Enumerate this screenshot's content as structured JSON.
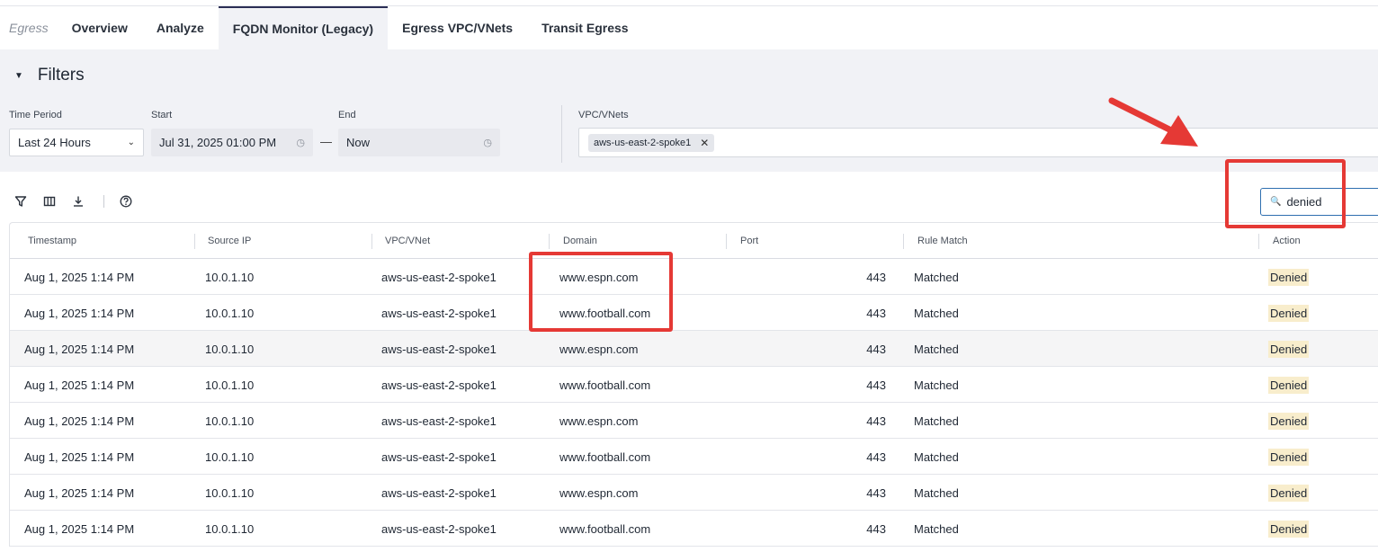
{
  "tabs": {
    "section": "Egress",
    "items": [
      "Overview",
      "Analyze",
      "FQDN Monitor (Legacy)",
      "Egress VPC/VNets",
      "Transit Egress"
    ],
    "active_index": 2
  },
  "filters": {
    "title": "Filters",
    "time_period": {
      "label": "Time Period",
      "value": "Last 24 Hours"
    },
    "start": {
      "label": "Start",
      "value": "Jul 31, 2025 01:00 PM"
    },
    "separator": "—",
    "end": {
      "label": "End",
      "value": "Now"
    },
    "vpc": {
      "label": "VPC/VNets",
      "chips": [
        "aws-us-east-2-spoke1"
      ]
    }
  },
  "toolbar": {
    "icons": [
      "filter-icon",
      "columns-icon",
      "download-icon",
      "help-icon"
    ],
    "search_value": "denied"
  },
  "table": {
    "columns": [
      "Timestamp",
      "Source IP",
      "VPC/VNet",
      "Domain",
      "Port",
      "Rule Match",
      "Action"
    ],
    "rows": [
      [
        "Aug 1, 2025 1:14 PM",
        "10.0.1.10",
        "aws-us-east-2-spoke1",
        "www.espn.com",
        "443",
        "Matched",
        "Denied"
      ],
      [
        "Aug 1, 2025 1:14 PM",
        "10.0.1.10",
        "aws-us-east-2-spoke1",
        "www.football.com",
        "443",
        "Matched",
        "Denied"
      ],
      [
        "Aug 1, 2025 1:14 PM",
        "10.0.1.10",
        "aws-us-east-2-spoke1",
        "www.espn.com",
        "443",
        "Matched",
        "Denied"
      ],
      [
        "Aug 1, 2025 1:14 PM",
        "10.0.1.10",
        "aws-us-east-2-spoke1",
        "www.football.com",
        "443",
        "Matched",
        "Denied"
      ],
      [
        "Aug 1, 2025 1:14 PM",
        "10.0.1.10",
        "aws-us-east-2-spoke1",
        "www.espn.com",
        "443",
        "Matched",
        "Denied"
      ],
      [
        "Aug 1, 2025 1:14 PM",
        "10.0.1.10",
        "aws-us-east-2-spoke1",
        "www.football.com",
        "443",
        "Matched",
        "Denied"
      ],
      [
        "Aug 1, 2025 1:14 PM",
        "10.0.1.10",
        "aws-us-east-2-spoke1",
        "www.espn.com",
        "443",
        "Matched",
        "Denied"
      ],
      [
        "Aug 1, 2025 1:14 PM",
        "10.0.1.10",
        "aws-us-east-2-spoke1",
        "www.football.com",
        "443",
        "Matched",
        "Denied"
      ]
    ],
    "highlighted_row": 2
  },
  "colors": {
    "accent": "#2b2f55",
    "annotation_red": "#e53935",
    "denied_bg": "#f8edcc",
    "filters_bg": "#f1f2f6"
  }
}
